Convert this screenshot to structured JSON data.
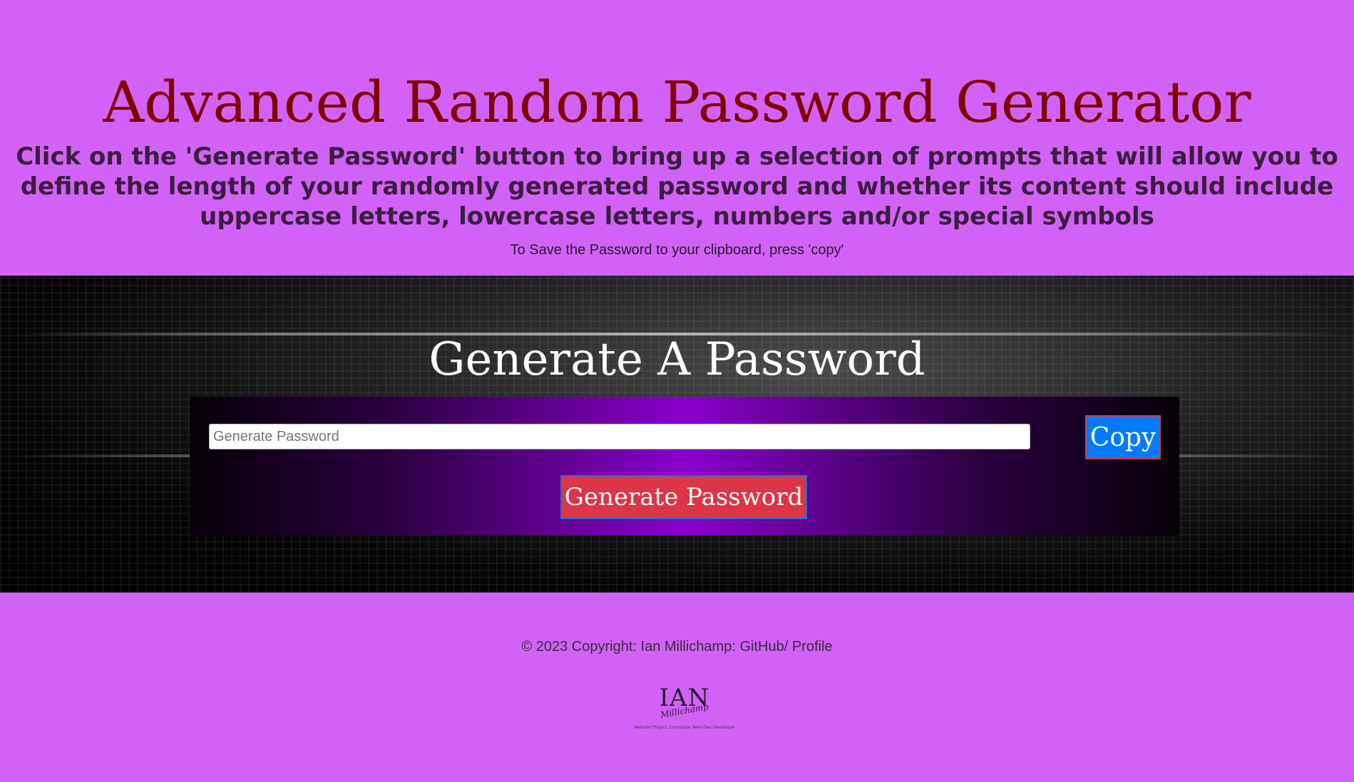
{
  "header": {
    "title": "Advanced Random Password Generator",
    "instructions": "Click on the 'Generate Password' button to bring up a selection of prompts that will allow you to define the length of your randomly generated password and whether its content should include uppercase letters, lowercase letters, numbers and/or special symbols",
    "clipboard_note": "To Save the Password to your clipboard, press 'copy'"
  },
  "card": {
    "title": "Generate A Password",
    "password_placeholder": "Generate Password",
    "copy_label": "Copy",
    "generate_label": "Generate Password"
  },
  "footer": {
    "copyright_prefix": "© 2023 Copyright: Ian Millichamp: ",
    "github_link": "GitHub/",
    "profile_link": " Profile",
    "logo_mark": "IAN",
    "logo_script": "Millichamp",
    "logo_tagline": "Website Project, Computer Web-Dev Developer"
  },
  "colors": {
    "page_background": "#d262f7",
    "title": "#7f0000",
    "copy_button": "#007bff",
    "generate_button": "#dc3545",
    "card_gradient_center": "#8a00cc"
  },
  "icons": []
}
